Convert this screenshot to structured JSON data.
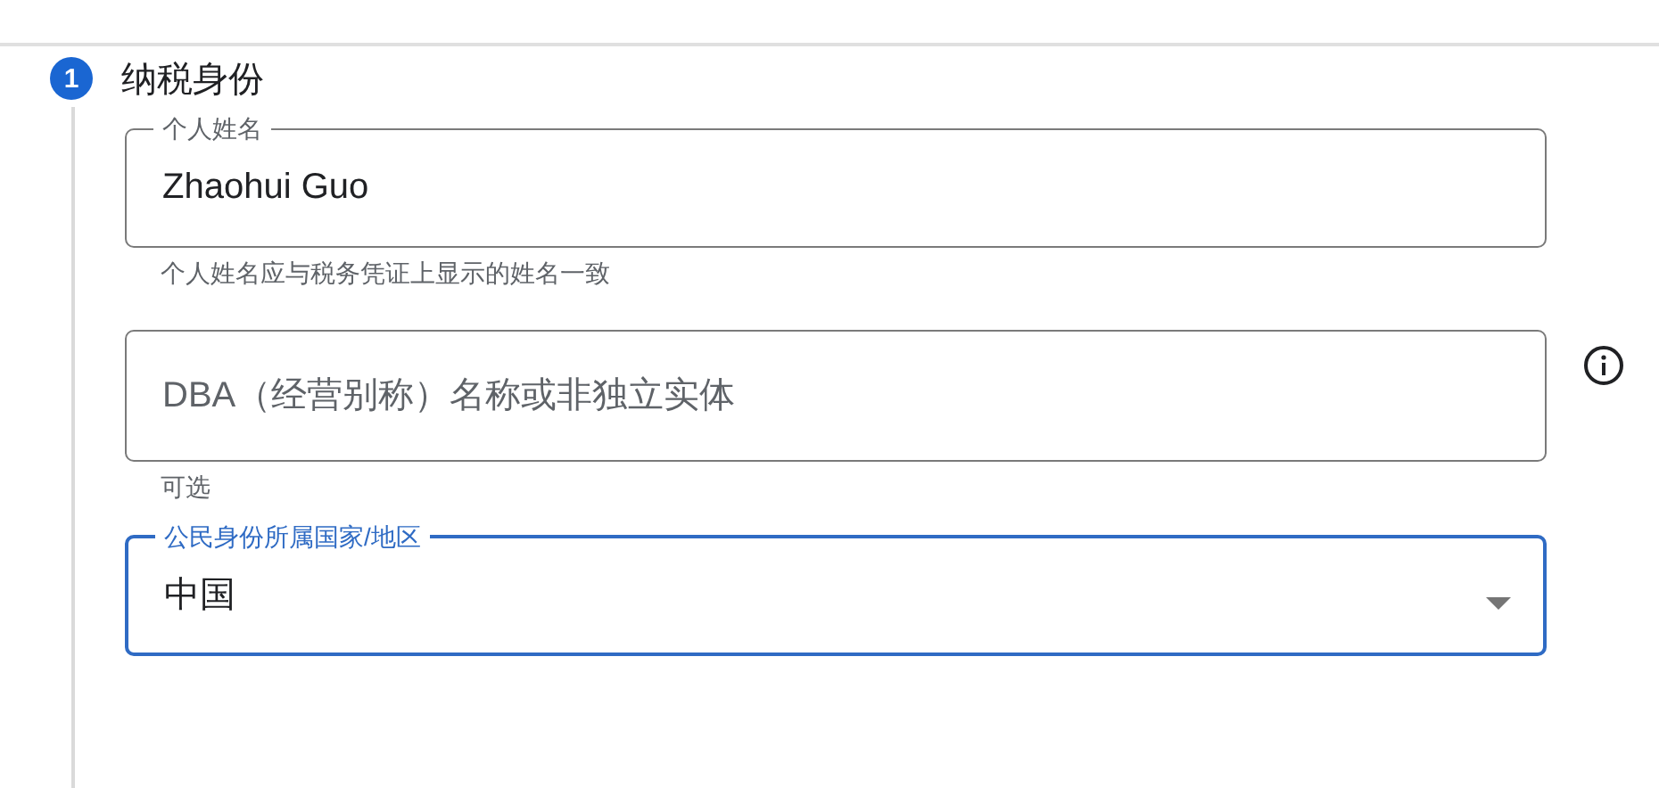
{
  "step": {
    "number": "1",
    "title": "纳税身份"
  },
  "fields": [
    {
      "kind": "text",
      "label": "个人姓名",
      "value": "Zhaohui Guo",
      "helper": "个人姓名应与税务凭证上显示的姓名一致",
      "focused": false,
      "info": false
    },
    {
      "kind": "text",
      "placeholder": "DBA（经营别称）名称或非独立实体",
      "helper": "可选",
      "focused": false,
      "info": true
    },
    {
      "kind": "select",
      "label": "公民身份所属国家/地区",
      "value": "中国",
      "focused": true,
      "info": false
    }
  ]
}
